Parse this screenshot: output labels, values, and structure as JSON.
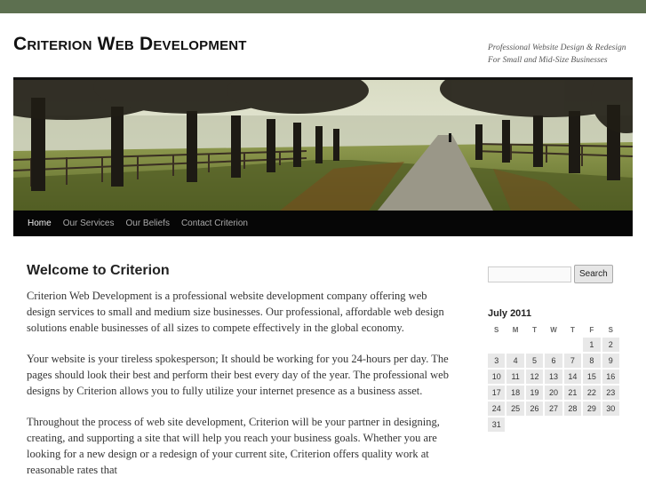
{
  "site": {
    "title": "Criterion Web Development",
    "tagline": "Professional Website Design & Redesign For Small and Mid-Size Businesses"
  },
  "nav": {
    "items": [
      "Home",
      "Our Services",
      "Our Beliefs",
      "Contact Criterion"
    ],
    "current": "Home"
  },
  "content": {
    "title": "Welcome to Criterion",
    "paragraphs": [
      "Criterion Web Development is a professional website development company offering web design services to small and medium size businesses. Our professional, affordable web design solutions enable businesses of all sizes to compete effectively in the global economy.",
      "Your website is your tireless spokesperson; It should be working for you 24-hours per day. The pages should look their best and perform their best every day of the year. The professional web designs by Criterion allows you to fully utilize your internet presence as a business asset.",
      "Throughout the process of web site development, Criterion will be your partner in designing, creating, and supporting a site that will help you reach your business goals. Whether you are looking for a new design or a redesign of your current site, Criterion offers quality work at reasonable rates that"
    ]
  },
  "sidebar": {
    "search": {
      "placeholder": "",
      "button_label": "Search"
    },
    "calendar": {
      "caption": "July 2011",
      "weekdays": [
        "S",
        "M",
        "T",
        "W",
        "T",
        "F",
        "S"
      ],
      "weeks": [
        [
          "",
          "",
          "",
          "",
          "",
          "1",
          "2"
        ],
        [
          "3",
          "4",
          "5",
          "6",
          "7",
          "8",
          "9"
        ],
        [
          "10",
          "11",
          "12",
          "13",
          "14",
          "15",
          "16"
        ],
        [
          "17",
          "18",
          "19",
          "20",
          "21",
          "22",
          "23"
        ],
        [
          "24",
          "25",
          "26",
          "27",
          "28",
          "29",
          "30"
        ],
        [
          "31",
          "",
          "",
          "",
          "",
          "",
          ""
        ]
      ]
    }
  },
  "colors": {
    "top_bar": "#5d7050",
    "nav_background": "#060606",
    "calendar_cell": "#e8e8e8"
  }
}
